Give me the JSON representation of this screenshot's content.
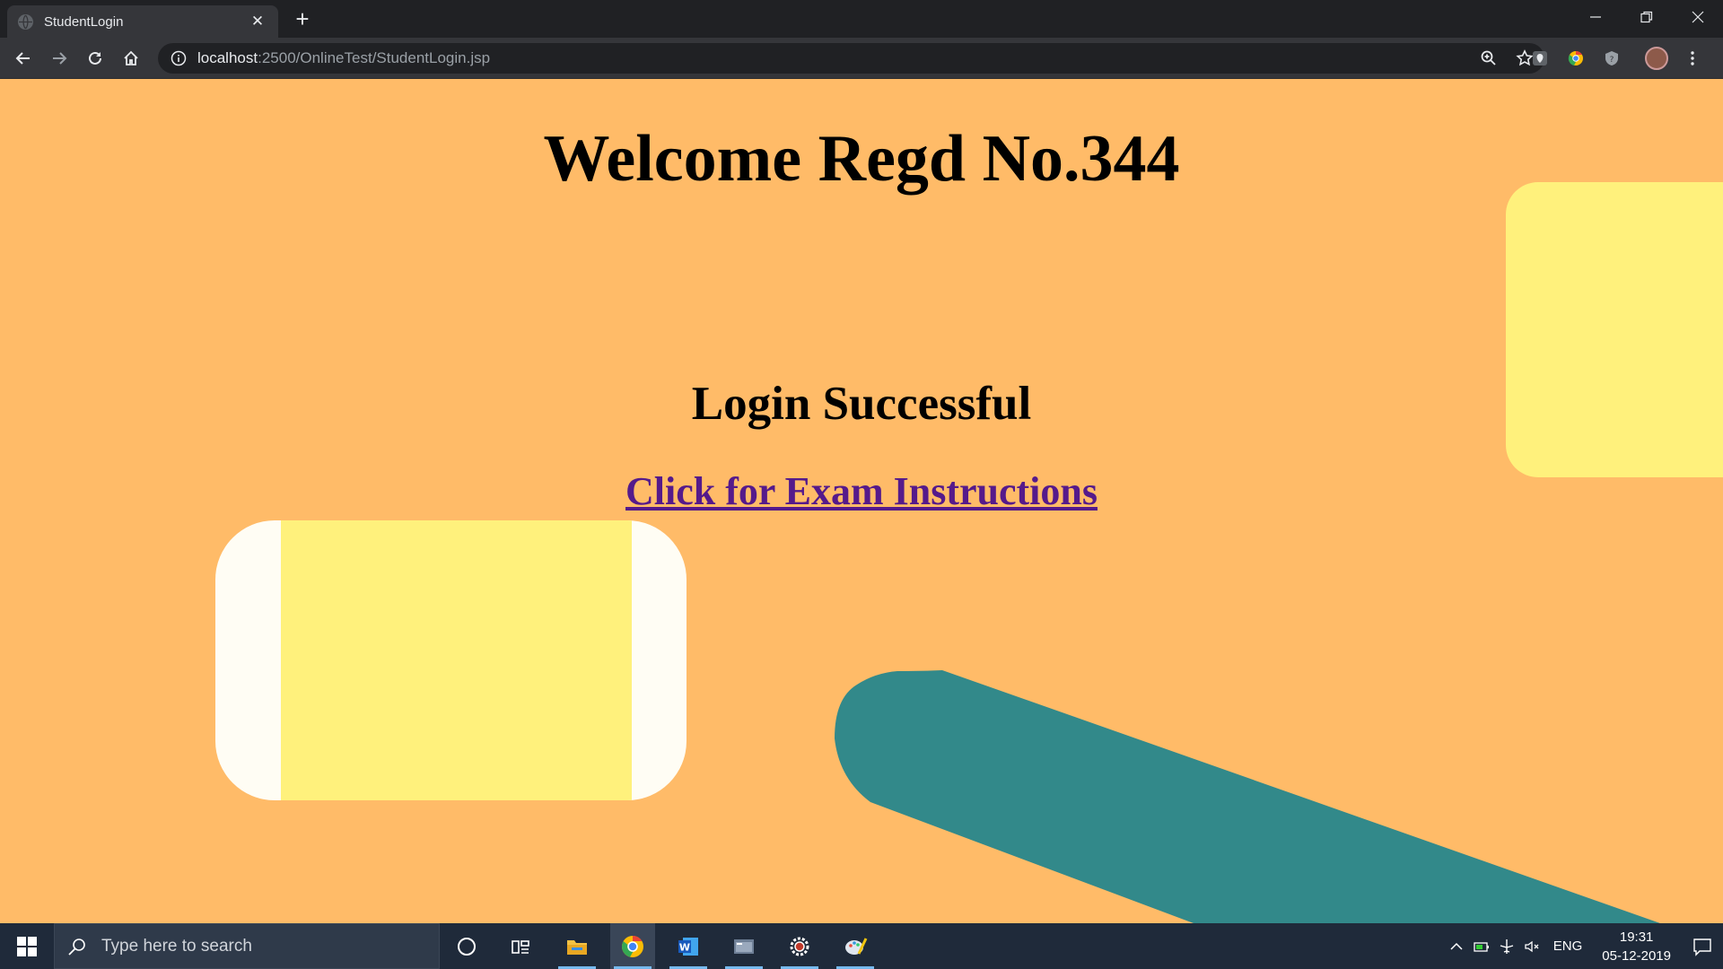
{
  "browser": {
    "tab_title": "StudentLogin",
    "url_host": "localhost",
    "url_rest": ":2500/OnlineTest/StudentLogin.jsp"
  },
  "page": {
    "heading": "Welcome Regd No.344",
    "status": "Login Successful",
    "link_text": "Click for Exam Instructions",
    "colors": {
      "background": "#ffbb68",
      "yellow": "#fff17c",
      "card_white": "#fffdf4",
      "teal": "#32898a",
      "link": "#551a8b"
    }
  },
  "taskbar": {
    "search_placeholder": "Type here to search",
    "language": "ENG",
    "time": "19:31",
    "date": "05-12-2019",
    "apps": [
      "cortana-icon",
      "task-view-icon",
      "file-explorer-icon",
      "chrome-icon",
      "word-icon",
      "app-window-icon",
      "settings-gear-icon",
      "paint-icon"
    ]
  }
}
